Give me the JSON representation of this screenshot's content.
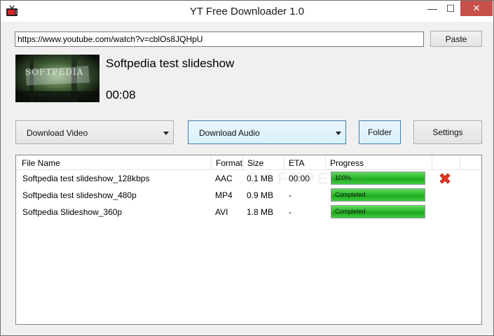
{
  "window": {
    "title": "YT Free Downloader 1.0",
    "minimize_glyph": "—",
    "maximize_glyph": "☐",
    "close_glyph": "✕"
  },
  "url_input": {
    "value": "https://www.youtube.com/watch?v=cblOs8JQHpU"
  },
  "paste_button": "Paste",
  "video": {
    "title": "Softpedia test slideshow",
    "duration": "00:08",
    "thumbnail_caption": "SOFTPEDIA"
  },
  "download_video_label": "Download Video",
  "download_audio_label": "Download Audio",
  "folder_button": "Folder",
  "settings_button": "Settings",
  "table": {
    "headers": [
      "File Name",
      "Format",
      "Size",
      "ETA",
      "Progress"
    ],
    "rows": [
      {
        "name": "Softpedia test slideshow_128kbps",
        "format": "AAC",
        "size": "0.1 MB",
        "eta": "00:00",
        "progress_text": "100%",
        "progress": 100,
        "removable": true
      },
      {
        "name": "Softpedia test slideshow_480p",
        "format": "MP4",
        "size": "0.9 MB",
        "eta": "-",
        "progress_text": "Completed",
        "progress": 100,
        "removable": false
      },
      {
        "name": "Softpedia Slideshow_360p",
        "format": "AVI",
        "size": "1.8 MB",
        "eta": "-",
        "progress_text": "Completed",
        "progress": 100,
        "removable": false
      }
    ]
  },
  "watermark": "SOFTPEDIA",
  "icons": {
    "app": "tv-icon",
    "remove": "remove-x-icon",
    "dropdown": "chevron-down-icon"
  },
  "colors": {
    "progress_fill": "#2dbb2d",
    "remove": "#e0341e",
    "close_button": "#c7504a",
    "accent_border": "#3c7fb1"
  }
}
